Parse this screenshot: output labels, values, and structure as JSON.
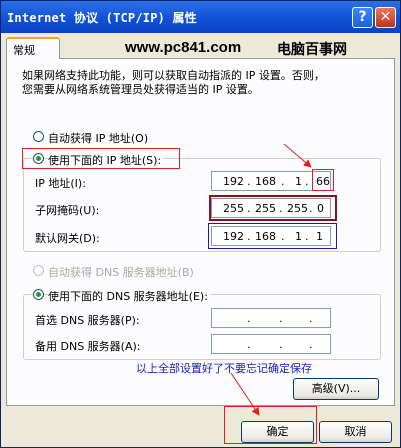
{
  "window": {
    "title": "Internet 协议 (TCP/IP) 属性",
    "help_glyph": "?",
    "close_glyph": "✕"
  },
  "tab": {
    "label": "常规"
  },
  "watermark": {
    "site": "www.pc841.com",
    "name": "电脑百事网"
  },
  "intro_lines": [
    "如果网络支持此功能，则可以获取自动指派的 IP 设置。否则，",
    "您需要从网络系统管理员处获得适当的 IP 设置。"
  ],
  "ip_mode": {
    "auto_label": "自动获得 IP 地址(O)",
    "manual_label": "使用下面的 IP 地址(S):",
    "selected": "manual"
  },
  "ip_fields": {
    "ip_label": "IP 地址(I):",
    "ip": [
      "192",
      "168",
      "1",
      "66"
    ],
    "mask_label": "子网掩码(U):",
    "mask": [
      "255",
      "255",
      "255",
      "0"
    ],
    "gateway_label": "默认网关(D):",
    "gateway": [
      "192",
      "168",
      "1",
      "1"
    ]
  },
  "dns_mode": {
    "auto_label": "自动获得 DNS 服务器地址(B)",
    "manual_label": "使用下面的 DNS 服务器地址(E):",
    "selected": "manual"
  },
  "dns_fields": {
    "preferred_label": "首选 DNS 服务器(P):",
    "alternate_label": "备用 DNS 服务器(A):",
    "preferred": [
      "",
      "",
      "",
      ""
    ],
    "alternate": [
      "",
      "",
      "",
      ""
    ]
  },
  "annotation_note": "以上全部设置好了不要忘记确定保存",
  "buttons": {
    "advanced": "高级(V)...",
    "ok": "确定",
    "cancel": "取消"
  },
  "colors": {
    "title_bar": "#1151d6",
    "annotation_red": "#e02020",
    "annotation_blue": "#1822c0"
  }
}
